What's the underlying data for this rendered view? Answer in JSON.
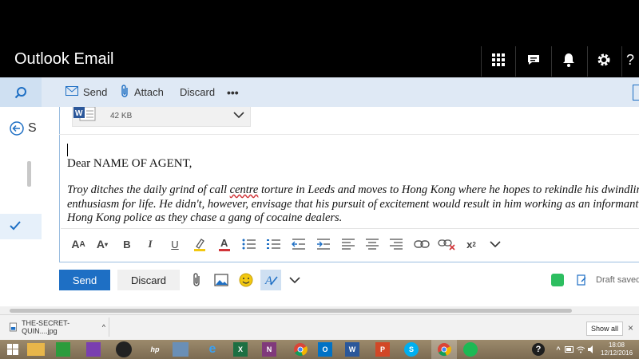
{
  "header": {
    "title": "Outlook Email",
    "icons": [
      "app-launcher-icon",
      "chat-icon",
      "bell-icon",
      "gear-icon",
      "help-icon"
    ]
  },
  "commandbar": {
    "send_label": "Send",
    "attach_label": "Attach",
    "discard_label": "Discard",
    "more_label": "•••"
  },
  "leftpane": {
    "back_label": "S"
  },
  "attachment": {
    "size": "42 KB"
  },
  "message": {
    "greeting": "Dear NAME OF AGENT,",
    "line1_a": "Troy ditches the daily grind of call ",
    "line1_spell": "centre",
    "line1_b": " torture in Leeds and moves to Hong Kong where he hopes to rekindle his dwindling",
    "line2": "enthusiasm for life. He didn't, however, envisage that his pursuit of excitement would result in him working as an informant for",
    "line3": "Hong Kong police as they chase a gang of cocaine dealers."
  },
  "actions": {
    "send_label": "Send",
    "discard_label": "Discard",
    "draft_status": "Draft saved a"
  },
  "downloads": {
    "file_name": "THE-SECRET-QUIN....jpg",
    "caret": "^",
    "show_all_label": "Show all",
    "close_label": "×"
  },
  "taskbar": {
    "time": "18:08",
    "date": "12/12/2016"
  },
  "colors": {
    "accent": "#1e6fc4",
    "header_bg": "#000000",
    "commandbar_bg": "#dfe9f5"
  }
}
